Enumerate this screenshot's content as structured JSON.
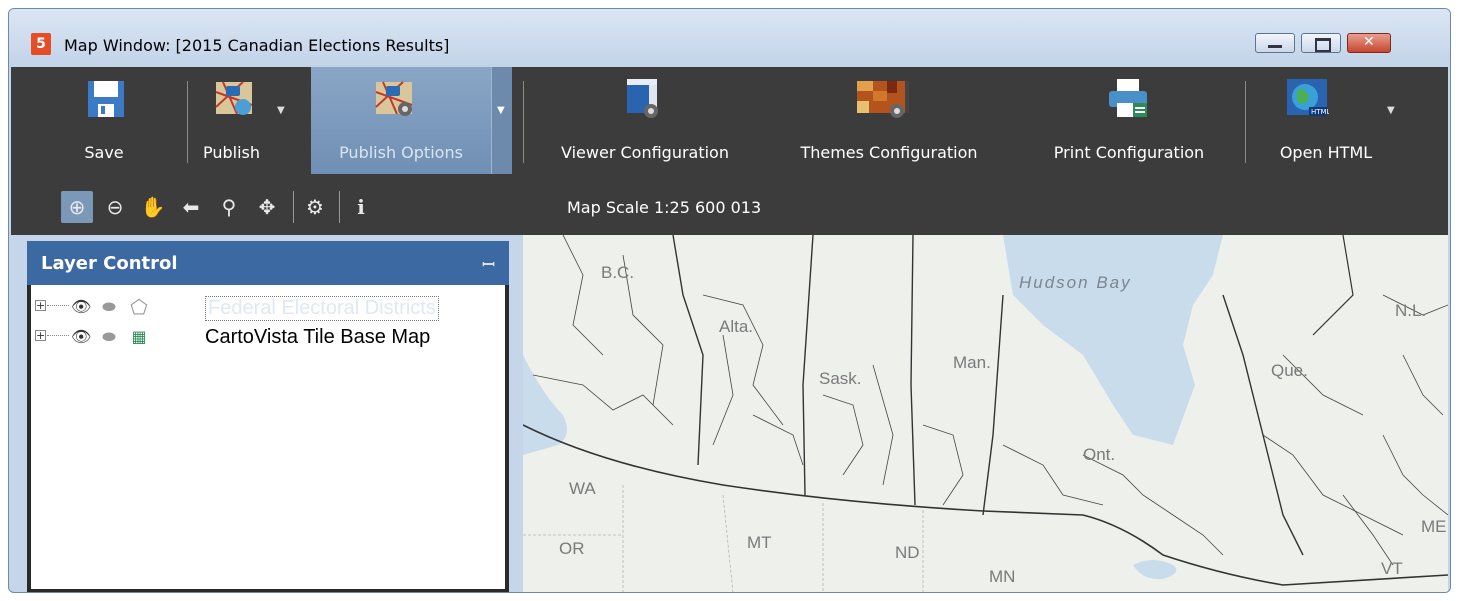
{
  "window": {
    "title": "Map Window: [2015 Canadian Elections Results]",
    "app_icon_glyph": "5"
  },
  "ribbon": {
    "buttons": [
      {
        "label": "Save",
        "icon": "floppy-disk-icon"
      },
      {
        "label": "Publish",
        "icon": "publish-map-icon"
      },
      {
        "label": "Publish Options",
        "icon": "publish-options-icon"
      },
      {
        "label": "Viewer Configuration",
        "icon": "viewer-config-icon"
      },
      {
        "label": "Themes Configuration",
        "icon": "themes-config-icon"
      },
      {
        "label": "Print Configuration",
        "icon": "printer-icon"
      },
      {
        "label": "Open HTML",
        "icon": "globe-html-icon"
      }
    ]
  },
  "toolbar": {
    "tools": [
      "zoom-in-icon",
      "zoom-out-icon",
      "pan-hand-icon",
      "back-arrow-icon",
      "zoom-extent-icon",
      "move-icon",
      "settings-gear-icon",
      "info-icon"
    ],
    "map_scale": "Map Scale 1:25 600 013"
  },
  "layer_control": {
    "title": "Layer Control",
    "pin_glyph": "ꟷ",
    "layers": [
      {
        "name": "Federal Electoral Districts",
        "selected": true
      },
      {
        "name": "CartoVista Tile Base Map",
        "selected": false
      }
    ]
  },
  "map": {
    "labels": {
      "bc": "B.C.",
      "alta": "Alta.",
      "sask": "Sask.",
      "man": "Man.",
      "hudson": "Hudson Bay",
      "nl": "N.L.",
      "que": "Que.",
      "ont": "Ont.",
      "wa": "WA",
      "or": "OR",
      "mt": "MT",
      "nd": "ND",
      "mn": "MN",
      "me": "ME",
      "vt": "VT"
    },
    "colors": {
      "land": "#eef0ec",
      "water": "#c9dcec",
      "border": "#333333"
    }
  },
  "colors": {
    "ribbon_bg": "#3c3c3c",
    "accent": "#3c69a2",
    "selected_tool": "#7b98b8"
  }
}
